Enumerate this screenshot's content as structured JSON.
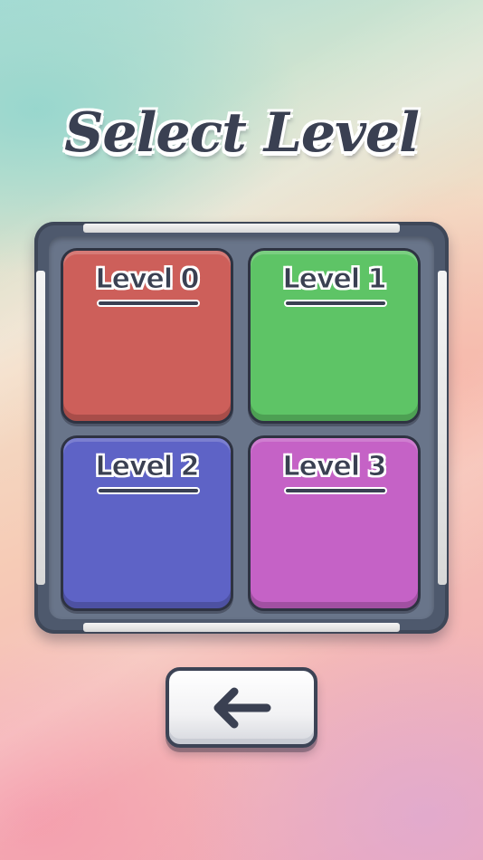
{
  "screen": {
    "title": "Select Level"
  },
  "levels": [
    {
      "label": "Level 0",
      "color": "#cd5f5a"
    },
    {
      "label": "Level 1",
      "color": "#5ec466"
    },
    {
      "label": "Level 2",
      "color": "#5e63c6"
    },
    {
      "label": "Level 3",
      "color": "#c562c6"
    }
  ],
  "back_button": {
    "icon": "arrow-left-icon"
  },
  "colors": {
    "board": "#4e596d",
    "outline": "#3a4052"
  }
}
